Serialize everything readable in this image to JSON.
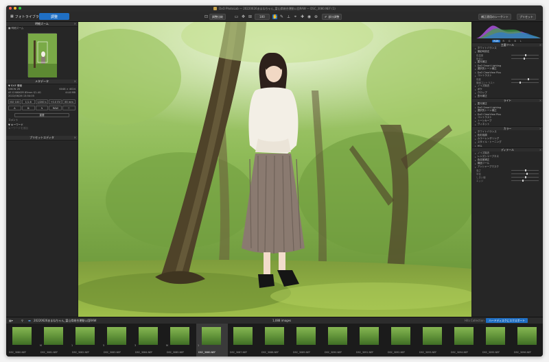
{
  "window": {
    "title": "DxO PhotoLab — 20220626あまねちゃん_富山県総合運動公園RAW — DSC_3080.NEF (1)"
  },
  "toolbar": {
    "tab_library": "フォトライブラリ",
    "tab_customize": "調整",
    "compare_label": "調整比較",
    "zoom_value": "100",
    "batch_label": "部分調整",
    "preset_label": "補正適用のシーケント",
    "preset_btn": "プリセット"
  },
  "left_panel": {
    "navigator_title": "明細ズーム",
    "navigator_sub": "■ 明細ズーム",
    "metadata_title": "メタデータ",
    "exif_header": "▼ EXIF 情報",
    "exif": [
      {
        "label": "NIKON Z6",
        "value": "6048 × 4024"
      },
      {
        "label": "AF-S NIKKOR 85mm f/1.4G",
        "value": "44.8 MB"
      },
      {
        "label": "2022/06/26 13:54:05",
        "value": ""
      }
    ],
    "chips_row1": [
      "ISO 100",
      "1/1.6",
      "1/200 s",
      "+0.0 EV",
      "85 mm"
    ],
    "chips_row2": [
      "A",
      "⊞",
      "↯",
      "RAW",
      "⚐"
    ],
    "rating_label": "重要",
    "rating_value": "コメント",
    "keywords_header": "▼ キーワード",
    "keywords_placeholder": "キーワードを追加",
    "preset_editor_title": "プリセットエディタ"
  },
  "right_panel": {
    "histogram_title": "ヒストグラム",
    "hist_tags": [
      "RGB",
      "R",
      "G",
      "B",
      "L"
    ],
    "sections": [
      {
        "title": "主要ツール",
        "rows": [
          "ホワイトバランス",
          "撮影時設定",
          "色温度",
          "色合い",
          "露光補正",
          "DxO Smart Lighting",
          "選択的トーン補正",
          "DxO ClearView Plus",
          "コントラスト",
          "彩度",
          "微細コントラスト",
          "ノイズ除去",
          "ボケ",
          "クロップ",
          "歪み補正"
        ]
      },
      {
        "title": "ライト",
        "rows": [
          "露光補正",
          "DxO Smart Lighting",
          "選択的トーン補正",
          "DxO ClearView Plus",
          "コントラスト",
          "トーンカーブ",
          "ヴィネット"
        ]
      },
      {
        "title": "カラー",
        "rows": [
          "ホワイトバランス",
          "色彩強調",
          "カラーレンダリング",
          "スタイル・トーニング",
          "HSL"
        ]
      },
      {
        "title": "ディテール",
        "rows": [
          "ノイズ除去",
          "レンズシャープネス",
          "色収差補正",
          "構造ツール",
          "アンシャープマスク",
          "強さ",
          "半径",
          "しきい値",
          "エッジ"
        ]
      }
    ],
    "wb_value": "4900",
    "tint_value": "18",
    "exposure_value": "0.00",
    "contrast_value": "0",
    "saturation_value": "0",
    "sharp_values": [
      "100",
      "0.50",
      "4",
      "0"
    ]
  },
  "status": {
    "folder_path": "20220626あまねちゃん_富山県総合運動公園RAW",
    "count": "1,088 images",
    "collection": "Hits Collection",
    "export_label": "ハードディスクにエクスポート"
  },
  "filmstrip": [
    {
      "num": "",
      "name": "DSC_3080.NEF"
    },
    {
      "num": "M",
      "name": "DSC_3081.NEF"
    },
    {
      "num": "1",
      "name": "DSC_3082.NEF"
    },
    {
      "num": "5",
      "name": "DSC_3083.NEF"
    },
    {
      "num": "3",
      "name": "DSC_3084.NEF"
    },
    {
      "num": "M",
      "name": "DSC_3085.NEF"
    },
    {
      "num": "1",
      "name": "DSC_3080.NEF"
    },
    {
      "num": "",
      "name": "DSC_3087.NEF"
    },
    {
      "num": "",
      "name": "DSC_3088.NEF"
    },
    {
      "num": "",
      "name": "DSC_3089.NEF"
    },
    {
      "num": "",
      "name": "DSC_3090.NEF"
    },
    {
      "num": "",
      "name": "DSC_3091.NEF"
    },
    {
      "num": "",
      "name": "DSC_3092.NEF"
    },
    {
      "num": "",
      "name": "DSC_3093.NEF"
    },
    {
      "num": "",
      "name": "DSC_3094.NEF"
    },
    {
      "num": "",
      "name": "DSC_3095.NEF"
    },
    {
      "num": "",
      "name": "DSC_3096.NEF"
    }
  ],
  "filmstrip_selected": 6,
  "colors": {
    "accent": "#1f6fc4",
    "panel": "#262626",
    "viewer": "#151515"
  }
}
